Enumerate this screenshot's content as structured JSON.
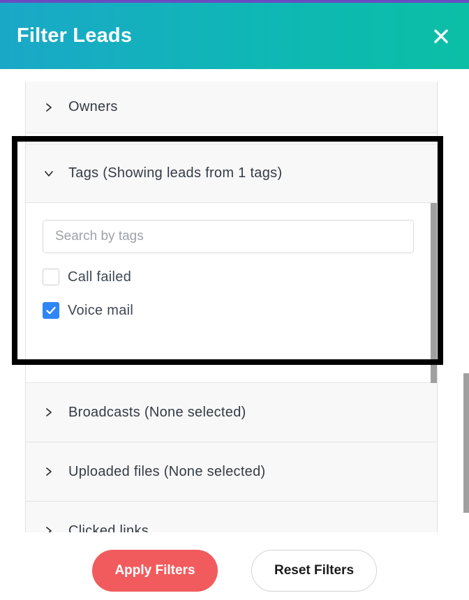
{
  "header": {
    "title": "Filter Leads",
    "close_icon": "close-icon",
    "accent_gradient_start": "#1aa8c8",
    "accent_gradient_end": "#0bbfa6"
  },
  "sections": {
    "owners": {
      "label": "Owners",
      "icon": "chevron-right-icon"
    },
    "tags": {
      "label": "Tags (Showing leads from 1 tags)",
      "icon": "chevron-down-icon",
      "search_placeholder": "Search by tags",
      "search_value": "",
      "options": [
        {
          "label": "Call failed",
          "checked": false
        },
        {
          "label": "Voice mail",
          "checked": true
        }
      ]
    },
    "broadcasts": {
      "label": "Broadcasts (None selected)",
      "icon": "chevron-right-icon"
    },
    "uploaded_files": {
      "label": "Uploaded files (None selected)",
      "icon": "chevron-right-icon"
    },
    "clicked_links": {
      "label": "Clicked links",
      "icon": "chevron-right-icon"
    }
  },
  "footer": {
    "apply_label": "Apply Filters",
    "reset_label": "Reset Filters",
    "apply_color": "#f15b5d"
  },
  "colors": {
    "checkbox_checked": "#2f86f6"
  }
}
